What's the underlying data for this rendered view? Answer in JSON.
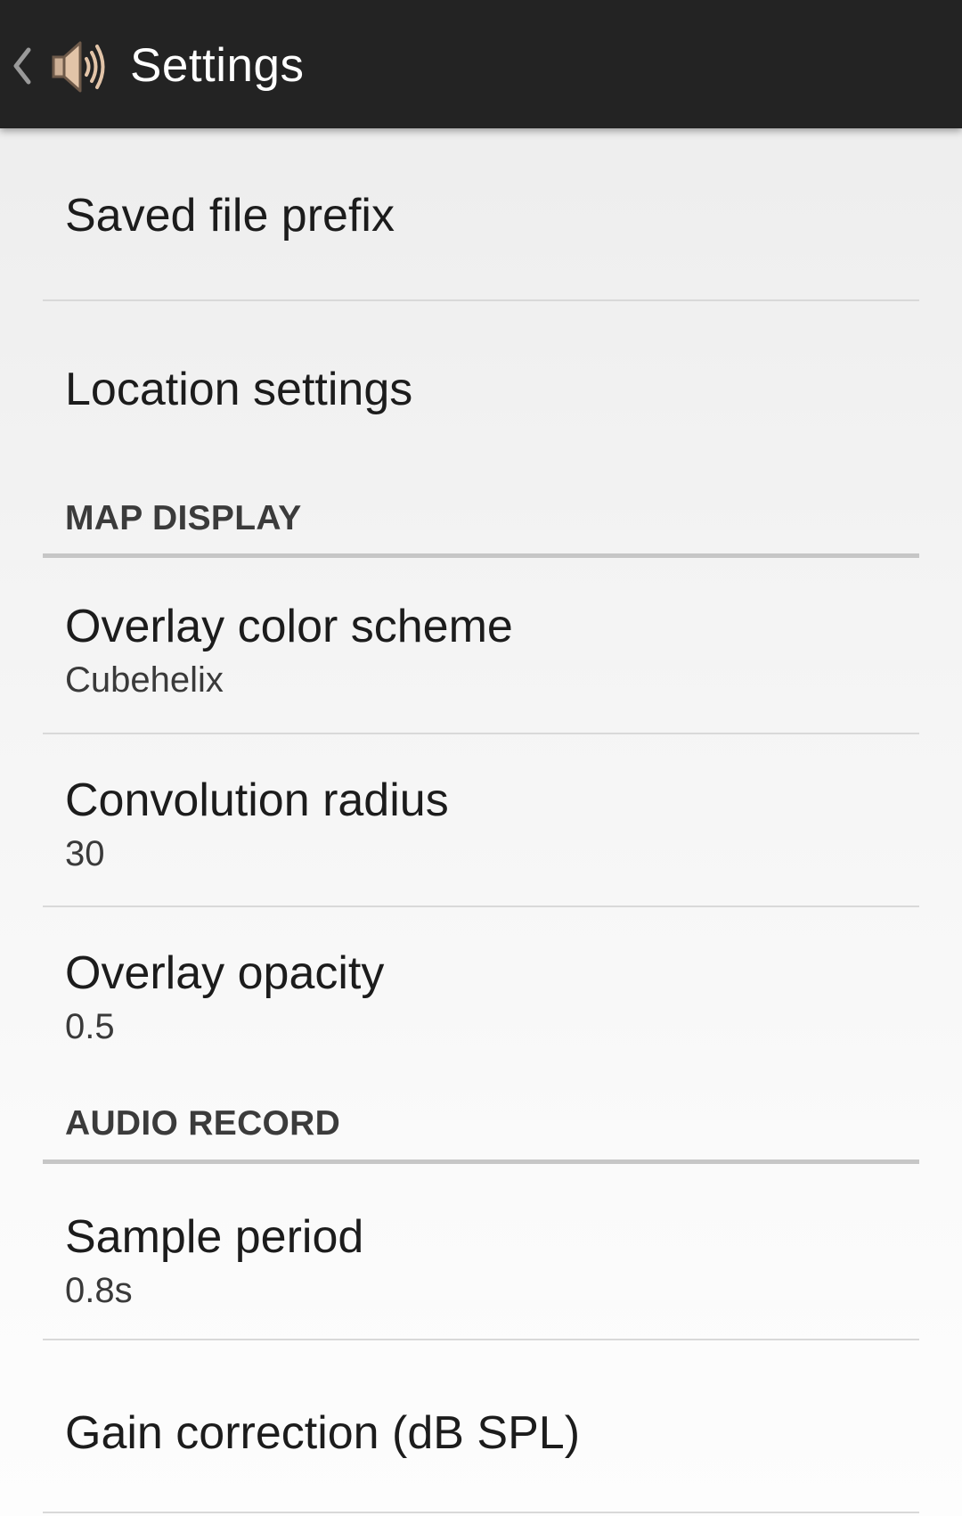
{
  "action_bar": {
    "title": "Settings",
    "back_icon": "chevron-left-icon",
    "app_icon": "speaker-icon"
  },
  "preferences": [
    {
      "title": "Saved file prefix",
      "summary": ""
    },
    {
      "title": "Location settings",
      "summary": ""
    }
  ],
  "map_display": {
    "header": "MAP DISPLAY",
    "items": [
      {
        "title": "Overlay color scheme",
        "summary": "Cubehelix"
      },
      {
        "title": "Convolution radius",
        "summary": "30"
      },
      {
        "title": "Overlay opacity",
        "summary": "0.5"
      }
    ]
  },
  "audio_record": {
    "header": "AUDIO RECORD",
    "items": [
      {
        "title": "Sample period",
        "summary": "0.8s"
      },
      {
        "title": "Gain correction (dB SPL)",
        "summary": ""
      }
    ]
  },
  "colors": {
    "action_bar": "#232323",
    "title_text": "#ffffff",
    "icon_speaker": "#e2c4a8"
  }
}
